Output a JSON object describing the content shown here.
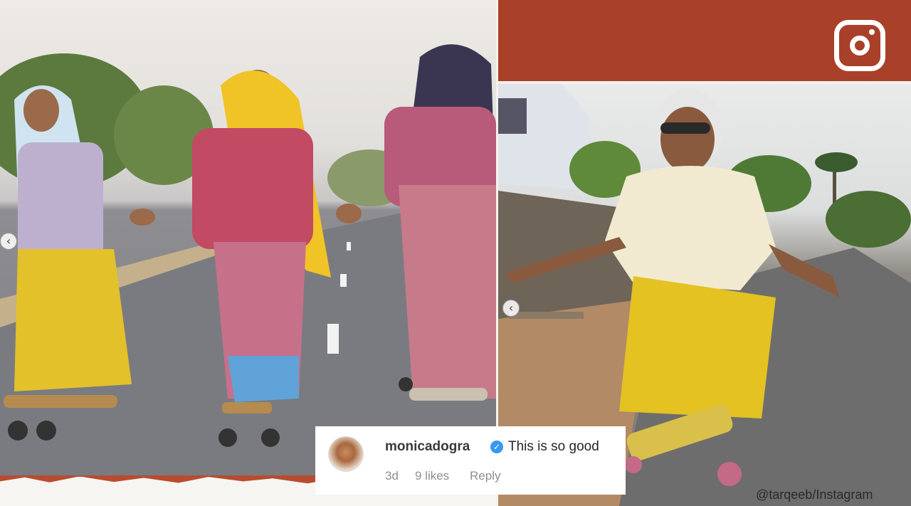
{
  "comment": {
    "username": "monicadogra",
    "text": "This is so good",
    "time": "3d",
    "likes": "9 likes",
    "reply": "Reply"
  },
  "credit": "@tarqeeb/Instagram",
  "colors": {
    "banner": "#a9402a",
    "verified": "#3897f0"
  },
  "icons": [
    "instagram-icon",
    "verified-icon",
    "carousel-prev-icon"
  ]
}
